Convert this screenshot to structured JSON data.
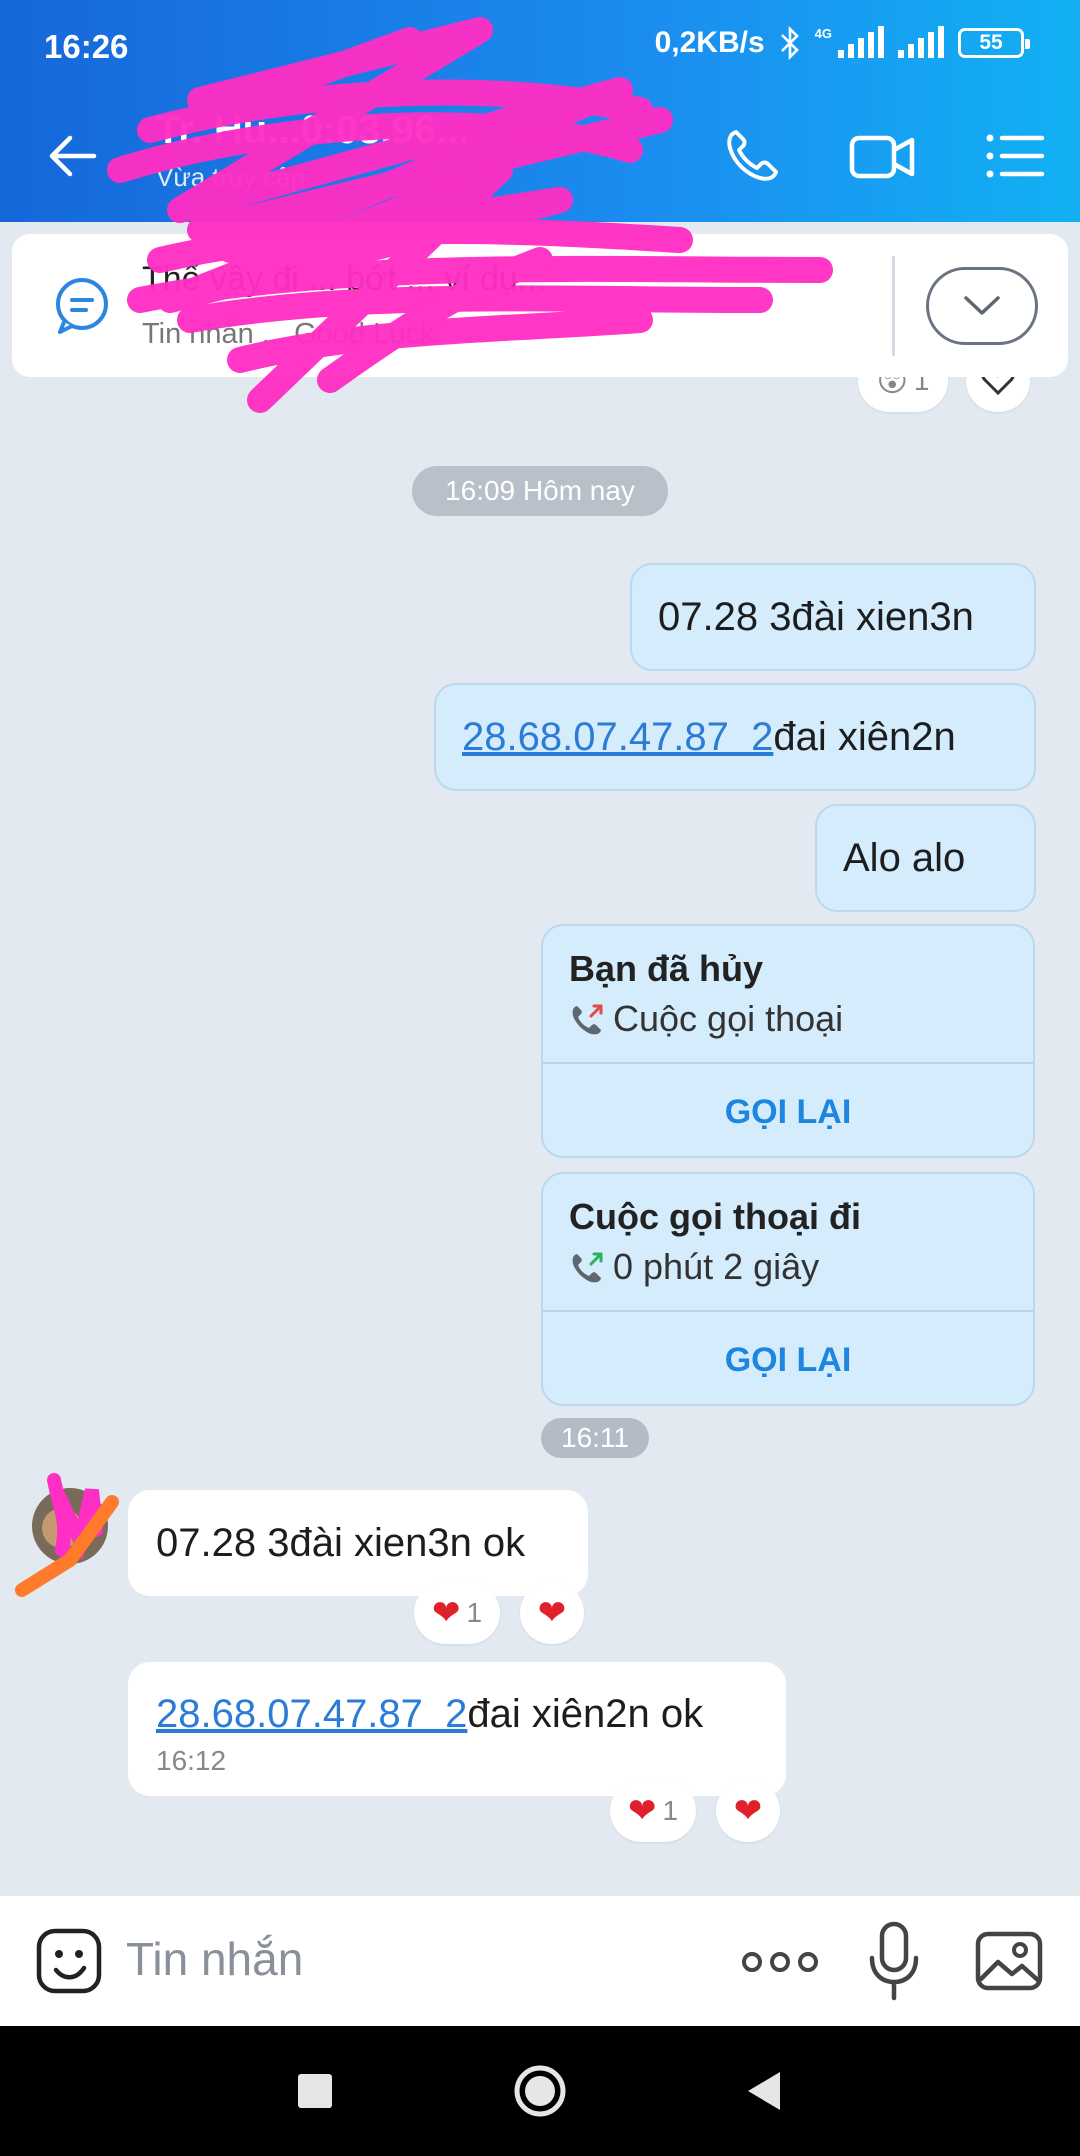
{
  "status": {
    "time": "16:26",
    "net_speed": "0,2KB/s",
    "network_type": "4G",
    "battery": "55"
  },
  "header": {
    "contact_name": "Tr. Hu...0:03.96...",
    "subtitle": "Vừa truy cập"
  },
  "pinned": {
    "title": "Thế vậy đi ... bớt ... ví dụ...",
    "subtitle": "Tin nhắn ... Good Luck"
  },
  "messages": {
    "date_chip": "16:09 Hôm nay",
    "out1": "07.28 3đài xien3n",
    "out2_link": "28.68.07.47.87  2",
    "out2_rest": "đai xiên2n",
    "out3": "Alo alo",
    "call1": {
      "title": "Bạn đã hủy",
      "detail": "Cuộc gọi thoại",
      "action": "GỌI LẠI"
    },
    "call2": {
      "title": "Cuộc gọi thoại đi",
      "detail": "0 phút 2 giây",
      "action": "GỌI LẠI"
    },
    "time_chip": "16:11",
    "in1": "07.28 3đài xien3n ok",
    "in1_reaction_count": "1",
    "in2_link": "28.68.07.47.87  2",
    "in2_rest": "đai xiên2n ok",
    "in2_time": "16:12",
    "in2_reaction_count": "1",
    "top_reaction_count": "1"
  },
  "input": {
    "placeholder": "Tin nhắn"
  },
  "colors": {
    "header": "#1b8df0",
    "bubble_out": "#d4ecfc",
    "accent": "#1f86e0",
    "heart": "#e0202b",
    "scribble": "#ff2ec4"
  }
}
